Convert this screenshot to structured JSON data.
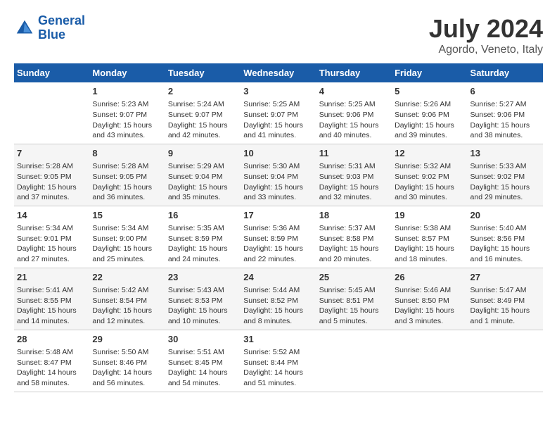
{
  "logo": {
    "line1": "General",
    "line2": "Blue"
  },
  "title": "July 2024",
  "subtitle": "Agordo, Veneto, Italy",
  "days_of_week": [
    "Sunday",
    "Monday",
    "Tuesday",
    "Wednesday",
    "Thursday",
    "Friday",
    "Saturday"
  ],
  "weeks": [
    [
      {
        "day": "",
        "info": ""
      },
      {
        "day": "1",
        "info": "Sunrise: 5:23 AM\nSunset: 9:07 PM\nDaylight: 15 hours\nand 43 minutes."
      },
      {
        "day": "2",
        "info": "Sunrise: 5:24 AM\nSunset: 9:07 PM\nDaylight: 15 hours\nand 42 minutes."
      },
      {
        "day": "3",
        "info": "Sunrise: 5:25 AM\nSunset: 9:07 PM\nDaylight: 15 hours\nand 41 minutes."
      },
      {
        "day": "4",
        "info": "Sunrise: 5:25 AM\nSunset: 9:06 PM\nDaylight: 15 hours\nand 40 minutes."
      },
      {
        "day": "5",
        "info": "Sunrise: 5:26 AM\nSunset: 9:06 PM\nDaylight: 15 hours\nand 39 minutes."
      },
      {
        "day": "6",
        "info": "Sunrise: 5:27 AM\nSunset: 9:06 PM\nDaylight: 15 hours\nand 38 minutes."
      }
    ],
    [
      {
        "day": "7",
        "info": "Sunrise: 5:28 AM\nSunset: 9:05 PM\nDaylight: 15 hours\nand 37 minutes."
      },
      {
        "day": "8",
        "info": "Sunrise: 5:28 AM\nSunset: 9:05 PM\nDaylight: 15 hours\nand 36 minutes."
      },
      {
        "day": "9",
        "info": "Sunrise: 5:29 AM\nSunset: 9:04 PM\nDaylight: 15 hours\nand 35 minutes."
      },
      {
        "day": "10",
        "info": "Sunrise: 5:30 AM\nSunset: 9:04 PM\nDaylight: 15 hours\nand 33 minutes."
      },
      {
        "day": "11",
        "info": "Sunrise: 5:31 AM\nSunset: 9:03 PM\nDaylight: 15 hours\nand 32 minutes."
      },
      {
        "day": "12",
        "info": "Sunrise: 5:32 AM\nSunset: 9:02 PM\nDaylight: 15 hours\nand 30 minutes."
      },
      {
        "day": "13",
        "info": "Sunrise: 5:33 AM\nSunset: 9:02 PM\nDaylight: 15 hours\nand 29 minutes."
      }
    ],
    [
      {
        "day": "14",
        "info": "Sunrise: 5:34 AM\nSunset: 9:01 PM\nDaylight: 15 hours\nand 27 minutes."
      },
      {
        "day": "15",
        "info": "Sunrise: 5:34 AM\nSunset: 9:00 PM\nDaylight: 15 hours\nand 25 minutes."
      },
      {
        "day": "16",
        "info": "Sunrise: 5:35 AM\nSunset: 8:59 PM\nDaylight: 15 hours\nand 24 minutes."
      },
      {
        "day": "17",
        "info": "Sunrise: 5:36 AM\nSunset: 8:59 PM\nDaylight: 15 hours\nand 22 minutes."
      },
      {
        "day": "18",
        "info": "Sunrise: 5:37 AM\nSunset: 8:58 PM\nDaylight: 15 hours\nand 20 minutes."
      },
      {
        "day": "19",
        "info": "Sunrise: 5:38 AM\nSunset: 8:57 PM\nDaylight: 15 hours\nand 18 minutes."
      },
      {
        "day": "20",
        "info": "Sunrise: 5:40 AM\nSunset: 8:56 PM\nDaylight: 15 hours\nand 16 minutes."
      }
    ],
    [
      {
        "day": "21",
        "info": "Sunrise: 5:41 AM\nSunset: 8:55 PM\nDaylight: 15 hours\nand 14 minutes."
      },
      {
        "day": "22",
        "info": "Sunrise: 5:42 AM\nSunset: 8:54 PM\nDaylight: 15 hours\nand 12 minutes."
      },
      {
        "day": "23",
        "info": "Sunrise: 5:43 AM\nSunset: 8:53 PM\nDaylight: 15 hours\nand 10 minutes."
      },
      {
        "day": "24",
        "info": "Sunrise: 5:44 AM\nSunset: 8:52 PM\nDaylight: 15 hours\nand 8 minutes."
      },
      {
        "day": "25",
        "info": "Sunrise: 5:45 AM\nSunset: 8:51 PM\nDaylight: 15 hours\nand 5 minutes."
      },
      {
        "day": "26",
        "info": "Sunrise: 5:46 AM\nSunset: 8:50 PM\nDaylight: 15 hours\nand 3 minutes."
      },
      {
        "day": "27",
        "info": "Sunrise: 5:47 AM\nSunset: 8:49 PM\nDaylight: 15 hours\nand 1 minute."
      }
    ],
    [
      {
        "day": "28",
        "info": "Sunrise: 5:48 AM\nSunset: 8:47 PM\nDaylight: 14 hours\nand 58 minutes."
      },
      {
        "day": "29",
        "info": "Sunrise: 5:50 AM\nSunset: 8:46 PM\nDaylight: 14 hours\nand 56 minutes."
      },
      {
        "day": "30",
        "info": "Sunrise: 5:51 AM\nSunset: 8:45 PM\nDaylight: 14 hours\nand 54 minutes."
      },
      {
        "day": "31",
        "info": "Sunrise: 5:52 AM\nSunset: 8:44 PM\nDaylight: 14 hours\nand 51 minutes."
      },
      {
        "day": "",
        "info": ""
      },
      {
        "day": "",
        "info": ""
      },
      {
        "day": "",
        "info": ""
      }
    ]
  ]
}
